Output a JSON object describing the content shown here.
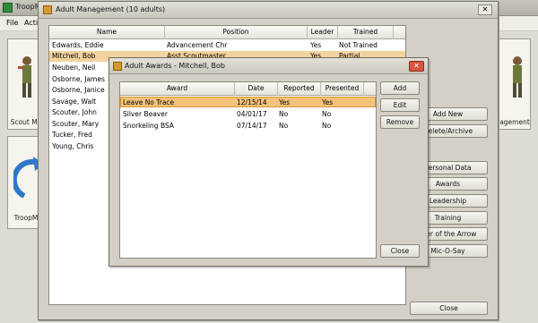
{
  "main": {
    "title": "TroopMa",
    "menu": [
      "File",
      "Activ"
    ],
    "tile1_caption": "Scout Ma",
    "tile2_caption": "TroopM",
    "tile3_caption": "agement"
  },
  "adult_mgmt": {
    "title": "Adult Management (10 adults)",
    "columns": [
      "Name",
      "Position",
      "Leader",
      "Trained"
    ],
    "rows": [
      {
        "name": "Edwards, Eddie",
        "position": "Advancement Chr",
        "leader": "Yes",
        "trained": "Not Trained"
      },
      {
        "name": "Mitchell, Bob",
        "position": "Asst Scoutmaster",
        "leader": "Yes",
        "trained": "Partial"
      },
      {
        "name": "Neuben, Neil",
        "position": "",
        "leader": "",
        "trained": ""
      },
      {
        "name": "Osborne, James",
        "position": "",
        "leader": "",
        "trained": ""
      },
      {
        "name": "Osborne, Janice",
        "position": "",
        "leader": "",
        "trained": ""
      },
      {
        "name": "Savage, Walt",
        "position": "",
        "leader": "",
        "trained": ""
      },
      {
        "name": "Scouter, John",
        "position": "",
        "leader": "",
        "trained": ""
      },
      {
        "name": "Scouter, Mary",
        "position": "",
        "leader": "",
        "trained": ""
      },
      {
        "name": "Tucker, Fred",
        "position": "",
        "leader": "",
        "trained": ""
      },
      {
        "name": "Young, Chris",
        "position": "",
        "leader": "",
        "trained": ""
      }
    ],
    "buttons": {
      "add_new": "Add New",
      "delete_archive": "Delete/Archive",
      "personal_data": "Personal Data",
      "awards": "Awards",
      "leadership": "Leadership",
      "training": "Training",
      "order_arrow": "rder of the Arrow",
      "mic_o_say": "Mic-O-Say",
      "close": "Close"
    }
  },
  "awards_dialog": {
    "title": "Adult Awards - Mitchell, Bob",
    "columns": [
      "Award",
      "Date",
      "Reported",
      "Presented"
    ],
    "rows": [
      {
        "award": "Leave No Trace",
        "date": "12/15/14",
        "reported": "Yes",
        "presented": "Yes"
      },
      {
        "award": "Silver Beaver",
        "date": "04/01/17",
        "reported": "No",
        "presented": "No"
      },
      {
        "award": "Snorkeling BSA",
        "date": "07/14/17",
        "reported": "No",
        "presented": "No"
      }
    ],
    "buttons": {
      "add": "Add",
      "edit": "Edit",
      "remove": "Remove",
      "close": "Close"
    }
  }
}
